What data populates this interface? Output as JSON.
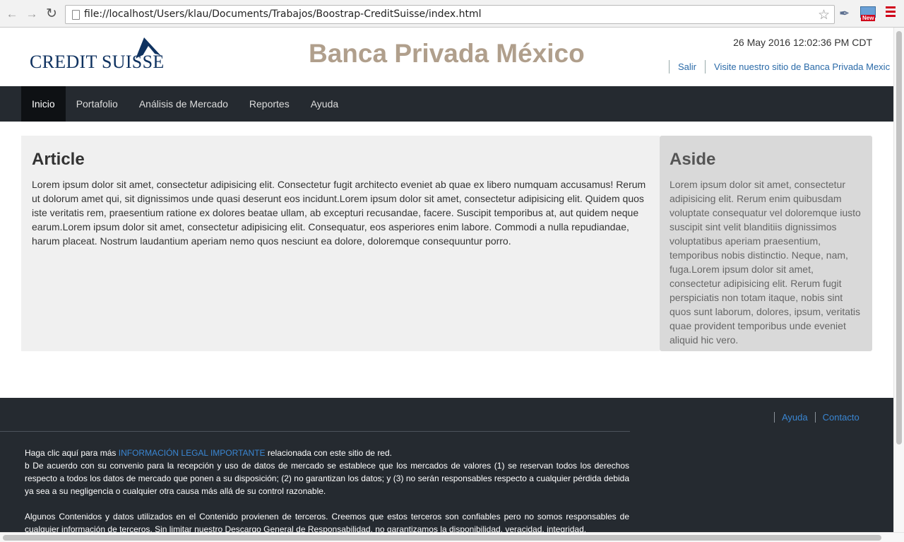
{
  "browser": {
    "url": "file://localhost/Users/klau/Documents/Trabajos/Boostrap-CreditSuisse/index.html",
    "extension_badge": "New",
    "icons": [
      "back-icon",
      "forward-icon",
      "reload-icon",
      "page-icon",
      "bookmark-star-icon",
      "eyedropper-icon",
      "extension-icon",
      "menu-icon"
    ]
  },
  "header": {
    "logo_text": "CREDIT SUISSE",
    "title": "Banca Privada México",
    "datetime": "26 May 2016 12:02:36 PM CDT",
    "links": [
      "Salir",
      "Visite nuestro sitio de Banca Privada Mexic"
    ]
  },
  "nav": {
    "items": [
      "Inicio",
      "Portafolio",
      "Análisis de Mercado",
      "Reportes",
      "Ayuda"
    ],
    "active": "Inicio"
  },
  "article": {
    "title": "Article",
    "body": "Lorem ipsum dolor sit amet, consectetur adipisicing elit. Consectetur fugit architecto eveniet ab quae ex libero numquam accusamus! Rerum ut dolorum amet qui, sit dignissimos unde quasi deserunt eos incidunt.Lorem ipsum dolor sit amet, consectetur adipisicing elit. Quidem quos iste veritatis rem, praesentium ratione ex dolores beatae ullam, ab excepturi recusandae, facere. Suscipit temporibus at, aut quidem neque earum.Lorem ipsum dolor sit amet, consectetur adipisicing elit. Consequatur, eos asperiores enim labore. Commodi a nulla repudiandae, harum placeat. Nostrum laudantium aperiam nemo quos nesciunt ea dolore, doloremque consequuntur porro."
  },
  "aside": {
    "title": "Aside",
    "body": "Lorem ipsum dolor sit amet, consectetur adipisicing elit. Rerum enim quibusdam voluptate consequatur vel doloremque iusto suscipit sint velit blanditiis dignissimos voluptatibus aperiam praesentium, temporibus nobis distinctio. Neque, nam, fuga.Lorem ipsum dolor sit amet, consectetur adipisicing elit. Rerum fugit perspiciatis non totam itaque, nobis sint quos sunt laborum, dolores, ipsum, veritatis quae provident temporibus unde eveniet aliquid hic vero."
  },
  "footer": {
    "links": [
      "Ayuda",
      "Contacto"
    ],
    "legal_intro_before": "Haga clic aquí para más ",
    "legal_link": "INFORMACIÓN LEGAL IMPORTANTE",
    "legal_intro_after": " relacionada con este sitio de red.",
    "legal_p1": "b De acuerdo con su convenio para la recepción y uso de datos de mercado se establece que los mercados de valores (1) se reservan todos los derechos respecto a todos los datos de mercado que ponen a su disposición; (2) no garantizan los datos; y (3) no serán responsables respecto a cualquier pérdida debida ya sea a su negligencia o cualquier otra causa más allá de su control razonable.",
    "legal_p2": "Algunos Contenidos y datos utilizados en el Contenido provienen de terceros. Creemos que estos terceros son confiables pero no somos responsables de cualquier información de terceros. Sin limitar nuestro Descargo General de Responsabilidad, no garantizamos la disponibilidad, veracidad, integridad,"
  },
  "colors": {
    "brand_navy": "#0f3260",
    "title_taupe": "#b09f8c",
    "nav_bg": "#252a30",
    "link_blue": "#2a6aa8",
    "footer_link_blue": "#3a86d2"
  }
}
